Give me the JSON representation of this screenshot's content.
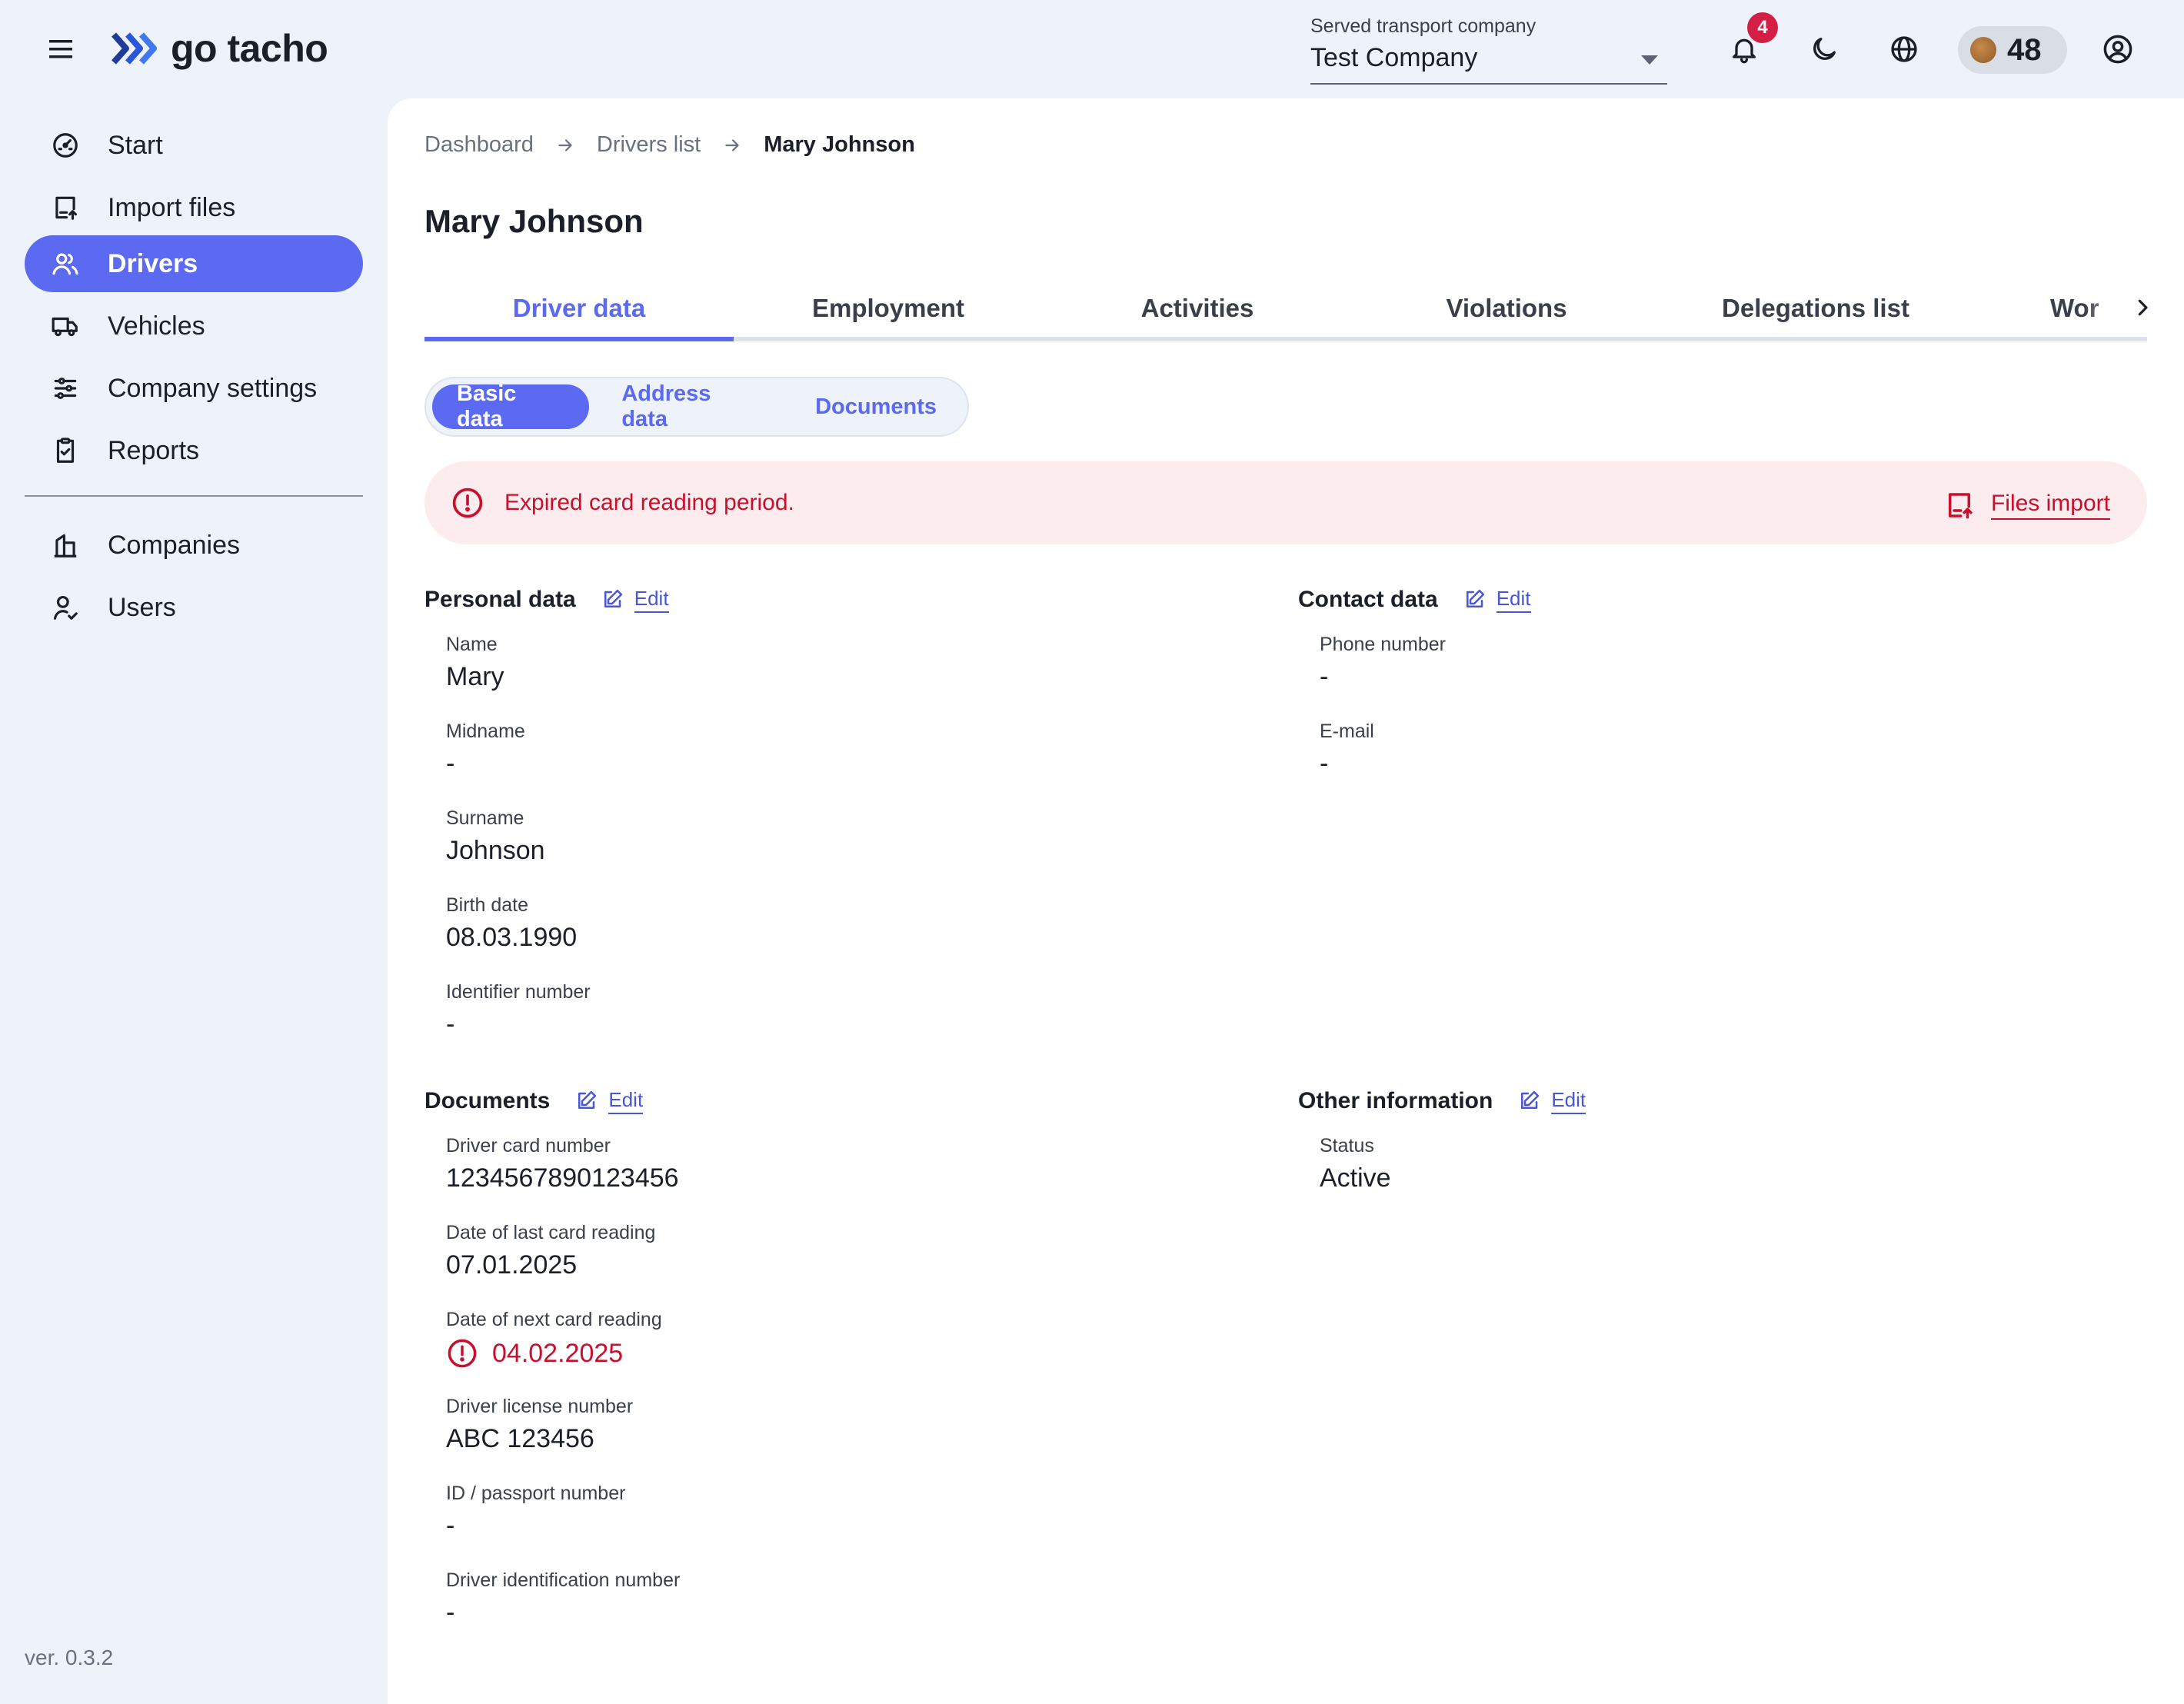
{
  "app": {
    "logo_text": "go tacho",
    "version": "ver. 0.3.2"
  },
  "topbar": {
    "company_label": "Served transport company",
    "company_value": "Test Company",
    "notifications_count": "4",
    "credits": "48"
  },
  "sidebar": {
    "items": [
      {
        "label": "Start",
        "icon": "speedometer-icon"
      },
      {
        "label": "Import files",
        "icon": "file-upload-icon"
      },
      {
        "label": "Drivers",
        "icon": "users-icon",
        "active": true
      },
      {
        "label": "Vehicles",
        "icon": "truck-icon"
      },
      {
        "label": "Company settings",
        "icon": "sliders-icon"
      },
      {
        "label": "Reports",
        "icon": "clipboard-icon"
      },
      {
        "label": "Companies",
        "icon": "building-icon"
      },
      {
        "label": "Users",
        "icon": "user-check-icon"
      }
    ]
  },
  "breadcrumb": [
    "Dashboard",
    "Drivers list",
    "Mary Johnson"
  ],
  "page_title": "Mary Johnson",
  "tabs": [
    "Driver data",
    "Employment",
    "Activities",
    "Violations",
    "Delegations list",
    "Wor"
  ],
  "subtabs": [
    "Basic data",
    "Address data",
    "Documents"
  ],
  "alert": {
    "message": "Expired card reading period.",
    "action": "Files import"
  },
  "edit_label": "Edit",
  "personal": {
    "title": "Personal data",
    "fields": [
      {
        "label": "Name",
        "value": "Mary"
      },
      {
        "label": "Midname",
        "value": "-"
      },
      {
        "label": "Surname",
        "value": "Johnson"
      },
      {
        "label": "Birth date",
        "value": "08.03.1990"
      },
      {
        "label": "Identifier number",
        "value": "-"
      }
    ]
  },
  "contact": {
    "title": "Contact data",
    "fields": [
      {
        "label": "Phone number",
        "value": "-"
      },
      {
        "label": "E-mail",
        "value": "-"
      }
    ]
  },
  "documents": {
    "title": "Documents",
    "fields": [
      {
        "label": "Driver card number",
        "value": "1234567890123456"
      },
      {
        "label": "Date of last card reading",
        "value": "07.01.2025"
      },
      {
        "label": "Date of next card reading",
        "value": "04.02.2025",
        "status": "expired"
      },
      {
        "label": "Driver license number",
        "value": "ABC 123456"
      },
      {
        "label": "ID / passport number",
        "value": "-"
      },
      {
        "label": "Driver identification number",
        "value": "-"
      }
    ]
  },
  "other": {
    "title": "Other information",
    "fields": [
      {
        "label": "Status",
        "value": "Active"
      }
    ]
  },
  "colors": {
    "accent": "#5b6af0",
    "danger": "#c8102e",
    "alert_bg": "#fdeced",
    "app_bg": "#eef3fb"
  }
}
